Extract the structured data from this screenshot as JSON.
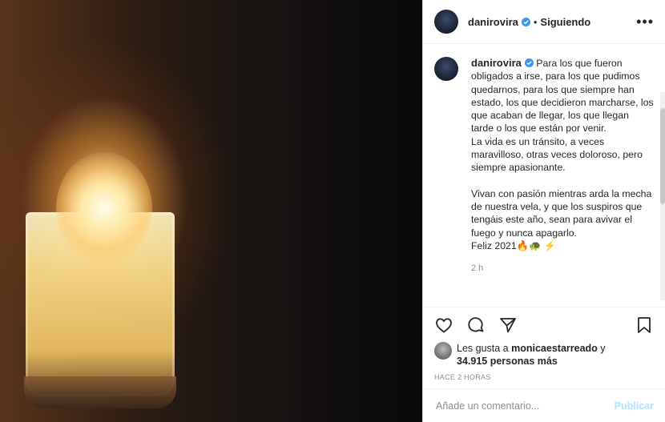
{
  "post": {
    "username": "danirovira",
    "follow_status": "Siguiendo",
    "more_icon": "more-dots-icon"
  },
  "caption": {
    "username": "danirovira",
    "p1": "Para los que fueron obligados a irse, para los que pudimos quedarnos, para los que siempre han estado, los que decidieron marcharse, los que acaban de llegar, los que llegan tarde o los que están por venir.",
    "p2": "La vida es un tránsito, a veces maravilloso, otras veces doloroso, pero siempre apasionante.",
    "p3": "Vivan con pasión mientras arda la mecha de nuestra vela, y que los suspiros que tengáis este año, sean para avivar el fuego y nunca apagarlo.",
    "p4": "Feliz 2021🔥🐢 ⚡",
    "time": "2 h"
  },
  "likes": {
    "prefix": "Les gusta a ",
    "user": "monicaestarreado",
    "mid": " y",
    "count": "34.915 personas más"
  },
  "post_age": "HACE 2 HORAS",
  "comment": {
    "placeholder": "Añade un comentario...",
    "publish": "Publicar"
  },
  "colors": {
    "verified": "#3897f0",
    "publish": "#b2dffc",
    "muted": "#8e8e8e"
  }
}
